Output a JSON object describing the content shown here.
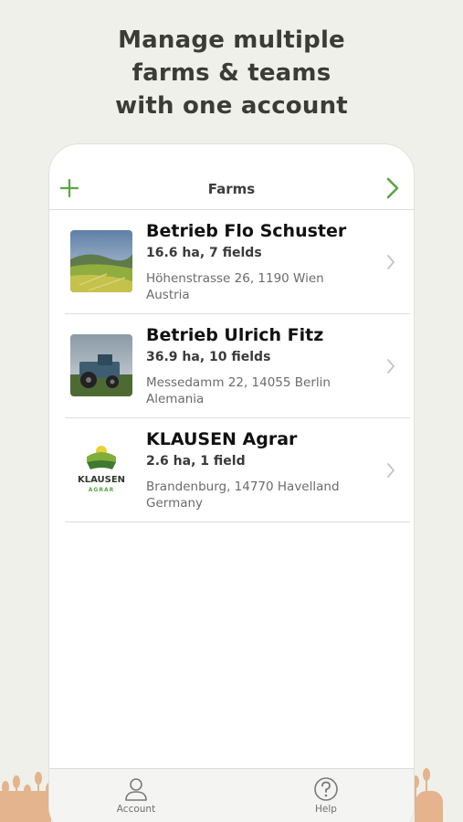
{
  "headline": {
    "line1": "Manage multiple",
    "line2": "farms & teams",
    "line3": "with one account"
  },
  "navbar": {
    "title": "Farms",
    "add_icon": "plus-icon",
    "next_icon": "chevron-right-icon",
    "accent_color": "#5aa544"
  },
  "farms": [
    {
      "name": "Betrieb Flo Schuster",
      "summary": "16.6 ha, 7 fields",
      "address_line1": "Höhenstrasse 26, 1190 Wien",
      "address_line2": "Austria",
      "thumbnail": "landscape-photo"
    },
    {
      "name": "Betrieb Ulrich Fitz",
      "summary": "36.9 ha, 10 fields",
      "address_line1": "Messedamm 22, 14055 Berlin",
      "address_line2": "Alemania",
      "thumbnail": "tractor-photo"
    },
    {
      "name": "KLAUSEN Agrar",
      "summary": "2.6 ha, 1 field",
      "address_line1": "Brandenburg, 14770  Havelland",
      "address_line2": "Germany",
      "thumbnail": "klausen-logo",
      "logo_text1": "KLAUSEN",
      "logo_text2": "AGRAR"
    }
  ],
  "tabbar": {
    "account_label": "Account",
    "help_label": "Help",
    "account_icon": "person-icon",
    "help_icon": "question-icon"
  }
}
